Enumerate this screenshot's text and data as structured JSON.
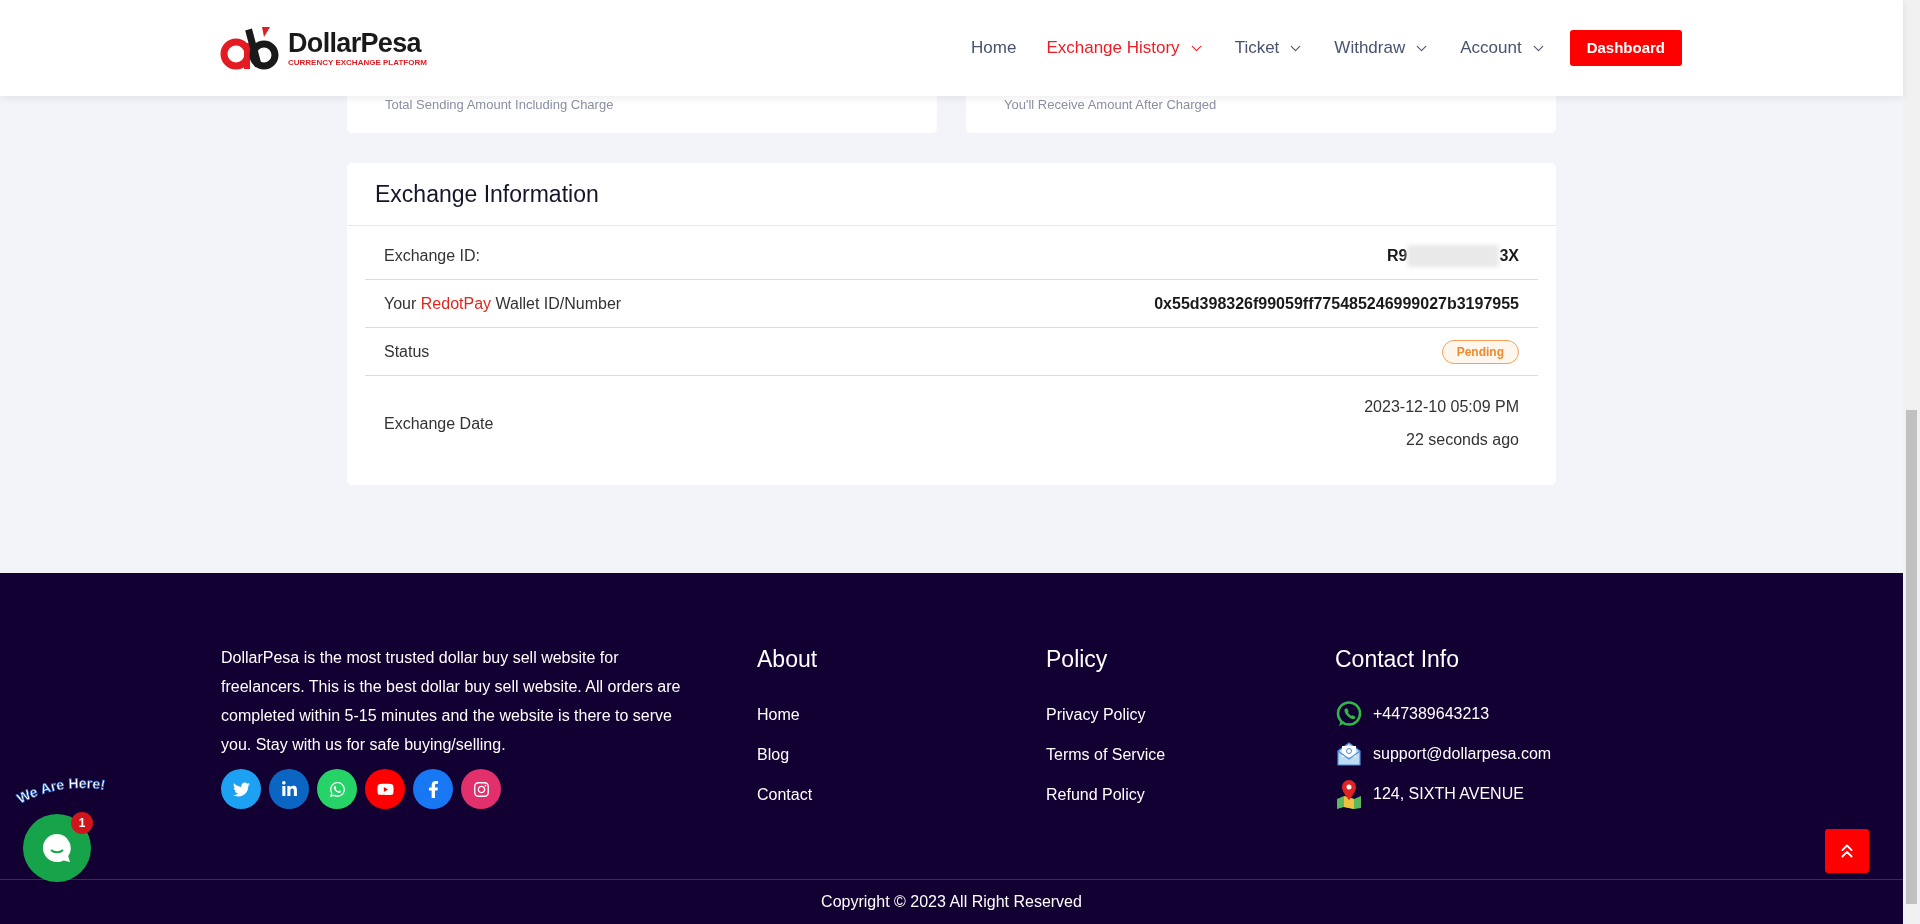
{
  "header": {
    "logo": {
      "name": "DollarPesa",
      "tagline": "CURRENCY EXCHANGE PLATFORM"
    },
    "nav": [
      {
        "label": "Home",
        "selected": false,
        "dropdown": false
      },
      {
        "label": "Exchange History",
        "selected": true,
        "dropdown": true
      },
      {
        "label": "Ticket",
        "selected": false,
        "dropdown": true
      },
      {
        "label": "Withdraw",
        "selected": false,
        "dropdown": true
      },
      {
        "label": "Account",
        "selected": false,
        "dropdown": true
      }
    ],
    "cta": "Dashboard"
  },
  "summary_cards": [
    {
      "caption": "Total Sending Amount Including Charge"
    },
    {
      "caption": "You'll Receive Amount After Charged"
    }
  ],
  "exchange_info": {
    "title": "Exchange Information",
    "rows": [
      {
        "kind": "text",
        "label": [
          {
            "text": "Exchange ID:",
            "highlight": false
          }
        ],
        "value_start": "R9",
        "value_end": "3X",
        "redacted": true
      },
      {
        "kind": "text",
        "label": [
          {
            "text": "Your ",
            "highlight": false
          },
          {
            "text": "RedotPay",
            "highlight": true
          },
          {
            "text": " Wallet ID/Number",
            "highlight": false
          }
        ],
        "value_start": "0x55d398326f99059ff775485246999027b3197955",
        "redacted": false
      },
      {
        "kind": "status",
        "label": [
          {
            "text": "Status",
            "highlight": false
          }
        ],
        "status": {
          "label": "Pending",
          "kind": "pending"
        }
      },
      {
        "kind": "date",
        "label": [
          {
            "text": "Exchange Date",
            "highlight": false
          }
        ],
        "date": "2023-12-10 05:09 PM",
        "relative": "22 seconds ago"
      }
    ]
  },
  "footer": {
    "about_text": "DollarPesa is the most trusted dollar buy sell website for freelancers. This is the best dollar buy sell website. All orders are completed within 5-15 minutes and the website is there to serve you. Stay with us for safe buying/selling.",
    "socials": [
      {
        "kind": "twitter",
        "color": "#1da1f2"
      },
      {
        "kind": "linkedin",
        "color": "#0a66c2"
      },
      {
        "kind": "whatsapp",
        "color": "#25d366"
      },
      {
        "kind": "youtube",
        "color": "#ff0000"
      },
      {
        "kind": "facebook",
        "color": "#1877f2"
      },
      {
        "kind": "instagram",
        "color": "#e1306c"
      }
    ],
    "columns": [
      {
        "title": "About",
        "links": [
          "Home",
          "Blog",
          "Contact"
        ]
      },
      {
        "title": "Policy",
        "links": [
          "Privacy Policy",
          "Terms of Service",
          "Refund Policy"
        ]
      }
    ],
    "contact": {
      "title": "Contact Info",
      "items": [
        {
          "kind": "phone",
          "text": "+447389643213"
        },
        {
          "kind": "email",
          "text": "support@dollarpesa.com"
        },
        {
          "kind": "address",
          "text": "124, SIXTH AVENUE"
        }
      ]
    },
    "copyright": "Copyright © 2023 All Right Reserved"
  },
  "chat_widget": {
    "greeting": "We Are Here!",
    "badge": "1"
  }
}
